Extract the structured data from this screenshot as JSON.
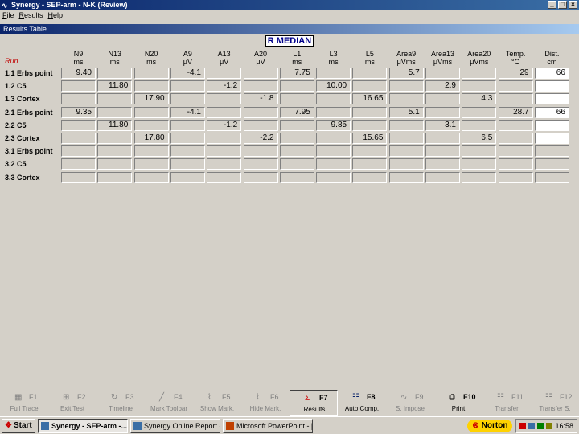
{
  "window": {
    "title": "Synergy  -  SEP-arm  -  N-K  (Review)"
  },
  "menu": [
    {
      "label": "File",
      "u": "F"
    },
    {
      "label": "Results",
      "u": "R"
    },
    {
      "label": "Help",
      "u": "H"
    }
  ],
  "panel": {
    "header": "Results Table",
    "title": "R MEDIAN",
    "run_label": "Run"
  },
  "columns": [
    {
      "name": "N9",
      "unit": "ms"
    },
    {
      "name": "N13",
      "unit": "ms"
    },
    {
      "name": "N20",
      "unit": "ms"
    },
    {
      "name": "A9",
      "unit": "μV"
    },
    {
      "name": "A13",
      "unit": "μV"
    },
    {
      "name": "A20",
      "unit": "μV"
    },
    {
      "name": "L1",
      "unit": "ms"
    },
    {
      "name": "L3",
      "unit": "ms"
    },
    {
      "name": "L5",
      "unit": "ms"
    },
    {
      "name": "Area9",
      "unit": "μVms"
    },
    {
      "name": "Area13",
      "unit": "μVms"
    },
    {
      "name": "Area20",
      "unit": "μVms"
    },
    {
      "name": "Temp.",
      "unit": "°C"
    },
    {
      "name": "Dist.",
      "unit": "cm"
    }
  ],
  "rows": [
    {
      "label": "1.1 Erbs point",
      "cells": [
        "9.40",
        "",
        "",
        "-4.1",
        "",
        "",
        "7.75",
        "",
        "",
        "5.7",
        "",
        "",
        "29",
        "66"
      ]
    },
    {
      "label": "1.2 C5",
      "cells": [
        "",
        "11.80",
        "",
        "",
        "-1.2",
        "",
        "",
        "10.00",
        "",
        "",
        "2.9",
        "",
        "",
        ""
      ]
    },
    {
      "label": "1.3 Cortex",
      "cells": [
        "",
        "",
        "17.90",
        "",
        "",
        "-1.8",
        "",
        "",
        "16.65",
        "",
        "",
        "4.3",
        "",
        ""
      ]
    },
    {
      "label": "2.1 Erbs point",
      "cells": [
        "9.35",
        "",
        "",
        "-4.1",
        "",
        "",
        "7.95",
        "",
        "",
        "5.1",
        "",
        "",
        "28.7",
        "66"
      ]
    },
    {
      "label": "2.2 C5",
      "cells": [
        "",
        "11.80",
        "",
        "",
        "-1.2",
        "",
        "",
        "9.85",
        "",
        "",
        "3.1",
        "",
        "",
        ""
      ]
    },
    {
      "label": "2.3 Cortex",
      "cells": [
        "",
        "",
        "17.80",
        "",
        "",
        "-2.2",
        "",
        "",
        "15.65",
        "",
        "",
        "6.5",
        "",
        ""
      ]
    },
    {
      "label": "3.1 Erbs point",
      "cells": [
        "",
        "",
        "",
        "",
        "",
        "",
        "",
        "",
        "",
        "",
        "",
        "",
        "",
        ""
      ]
    },
    {
      "label": "3.2 C5",
      "cells": [
        "",
        "",
        "",
        "",
        "",
        "",
        "",
        "",
        "",
        "",
        "",
        "",
        "",
        ""
      ]
    },
    {
      "label": "3.3 Cortex",
      "cells": [
        "",
        "",
        "",
        "",
        "",
        "",
        "",
        "",
        "",
        "",
        "",
        "",
        "",
        ""
      ]
    }
  ],
  "fkeys": [
    {
      "fn": "F1",
      "label": "Full Trace",
      "icon": "full-trace-icon",
      "glyph": "▦",
      "state": "disabled"
    },
    {
      "fn": "F2",
      "label": "Exit Test",
      "icon": "exit-test-icon",
      "glyph": "⊞",
      "state": "disabled"
    },
    {
      "fn": "F3",
      "label": "Timeline",
      "icon": "timeline-icon",
      "glyph": "↻",
      "state": "disabled"
    },
    {
      "fn": "F4",
      "label": "Mark Toolbar",
      "icon": "mark-toolbar-icon",
      "glyph": "╱",
      "state": "disabled"
    },
    {
      "fn": "F5",
      "label": "Show Mark.",
      "icon": "show-markers-icon",
      "glyph": "⌇",
      "state": "disabled"
    },
    {
      "fn": "F6",
      "label": "Hide Mark.",
      "icon": "hide-markers-icon",
      "glyph": "⌇",
      "state": "disabled"
    },
    {
      "fn": "F7",
      "label": "Results",
      "icon": "sigma-icon",
      "glyph": "Σ",
      "state": "active"
    },
    {
      "fn": "F8",
      "label": "Auto Comp.",
      "icon": "auto-compare-icon",
      "glyph": "☷",
      "state": "enabled"
    },
    {
      "fn": "F9",
      "label": "S. Impose",
      "icon": "superimpose-icon",
      "glyph": "∿",
      "state": "disabled"
    },
    {
      "fn": "F10",
      "label": "Print",
      "icon": "printer-icon",
      "glyph": "⎙",
      "state": "enabled"
    },
    {
      "fn": "F11",
      "label": "Transfer",
      "icon": "transfer-icon",
      "glyph": "☷",
      "state": "disabled"
    },
    {
      "fn": "F12",
      "label": "Transfer S.",
      "icon": "transfer-s-icon",
      "glyph": "☷",
      "state": "disabled"
    }
  ],
  "taskbar": {
    "start": "Start",
    "tasks": [
      {
        "label": "Synergy  -  SEP-arm  -...",
        "active": true
      },
      {
        "label": "Synergy Online Report - ...",
        "active": false
      },
      {
        "label": "Microsoft PowerPoint - [...",
        "active": false
      }
    ],
    "norton": "Norton",
    "clock": "16:58"
  },
  "colors": {
    "title_bar": "#0a246a",
    "run_label": "#c00000",
    "title_text": "#00008b"
  }
}
